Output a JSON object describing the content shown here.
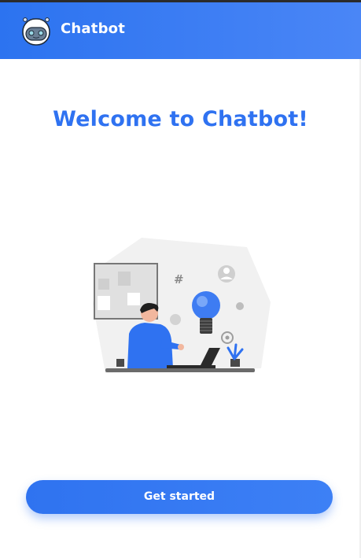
{
  "header": {
    "app_title": "Chatbot",
    "logo_icon": "robot-face-icon"
  },
  "main": {
    "welcome_title": "Welcome to Chatbot!",
    "illustration_icon": "person-idea-laptop-illustration"
  },
  "actions": {
    "get_started_label": "Get started"
  },
  "colors": {
    "header_bg": "#2c73f0",
    "accent": "#2f72f1",
    "button_bg": "#2f73f0"
  }
}
